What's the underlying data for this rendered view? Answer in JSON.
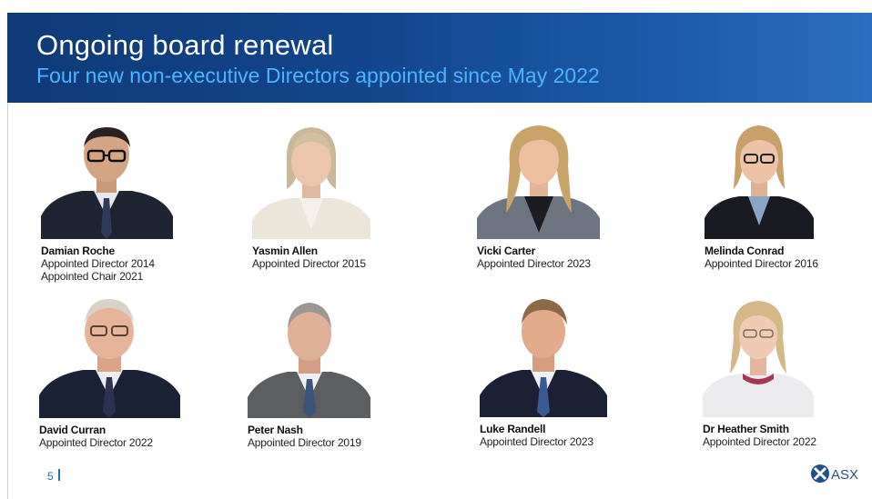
{
  "slide": {
    "title": "Ongoing board renewal",
    "subtitle": "Four new non-executive Directors appointed since May 2022",
    "page_number": "5",
    "logo_text": "ASX"
  },
  "directors": [
    {
      "name": "Damian Roche",
      "roles": [
        "Appointed Director 2014",
        "Appointed Chair 2021"
      ]
    },
    {
      "name": "Yasmin Allen",
      "roles": [
        "Appointed Director 2015"
      ]
    },
    {
      "name": "Vicki Carter",
      "roles": [
        "Appointed Director 2023"
      ]
    },
    {
      "name": "Melinda Conrad",
      "roles": [
        "Appointed Director 2016"
      ]
    },
    {
      "name": "David Curran",
      "roles": [
        "Appointed Director 2022"
      ]
    },
    {
      "name": "Peter Nash",
      "roles": [
        "Appointed Director 2019"
      ]
    },
    {
      "name": "Luke Randell",
      "roles": [
        "Appointed Director 2023"
      ]
    },
    {
      "name": "Dr Heather Smith",
      "roles": [
        "Appointed Director 2022"
      ]
    }
  ],
  "colors": {
    "banner": "#12458b",
    "subtitle": "#4db3ff",
    "accent": "#1a73c9"
  }
}
